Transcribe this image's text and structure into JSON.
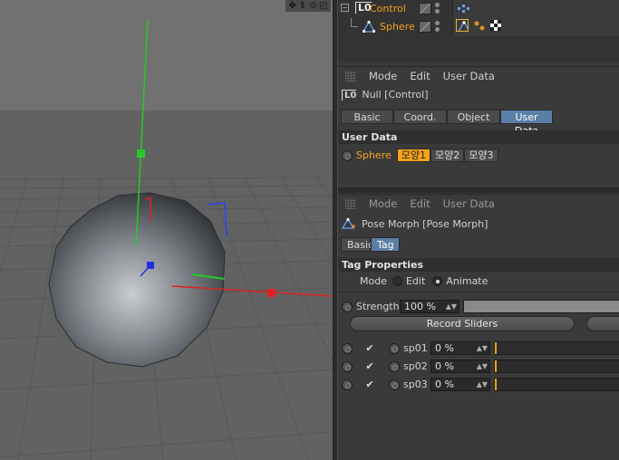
{
  "viewport": {
    "nav_icons": [
      "move-icon",
      "scale-icon",
      "rotate-icon",
      "maximize-icon"
    ],
    "nav_glyphs": [
      "✥",
      "⇕",
      "⊙",
      "◰"
    ]
  },
  "objects": {
    "control": {
      "name": "Control",
      "icon_glyph": "L0"
    },
    "sphere": {
      "name": "Sphere"
    }
  },
  "am1": {
    "menu": [
      "Mode",
      "Edit",
      "User Data"
    ],
    "title": "Null [Control]",
    "tabs": [
      "Basic",
      "Coord.",
      "Object",
      "User Data"
    ],
    "active_tab": "User Data",
    "section": "User Data",
    "sphere_label": "Sphere",
    "buttons": [
      "모양1",
      "모양2",
      "모양3"
    ],
    "active_button": "모양1"
  },
  "am2": {
    "menu": [
      "Mode",
      "Edit",
      "User Data"
    ],
    "title": "Pose Morph [Pose Morph]",
    "tabs": [
      "Basic",
      "Tag"
    ],
    "active_tab": "Tag",
    "section": "Tag Properties",
    "mode_label": "Mode",
    "mode_options": [
      "Edit",
      "Animate"
    ],
    "mode_selected": "Animate",
    "strength_label": "Strength",
    "strength_value": "100 %",
    "strength_fraction": 1.0,
    "record_button": "Record Sliders",
    "poses": [
      {
        "name": "sp01",
        "value": "0 %",
        "fraction": 0.0,
        "checked": true
      },
      {
        "name": "sp02",
        "value": "0 %",
        "fraction": 0.0,
        "checked": true
      },
      {
        "name": "sp03",
        "value": "0 %",
        "fraction": 0.0,
        "checked": true
      }
    ]
  },
  "colors": {
    "accent_orange": "#f5a21c",
    "tab_active_blue": "#5a7fa6",
    "axis_x": "#e02020",
    "axis_y": "#20c020",
    "axis_z": "#2030e0"
  }
}
